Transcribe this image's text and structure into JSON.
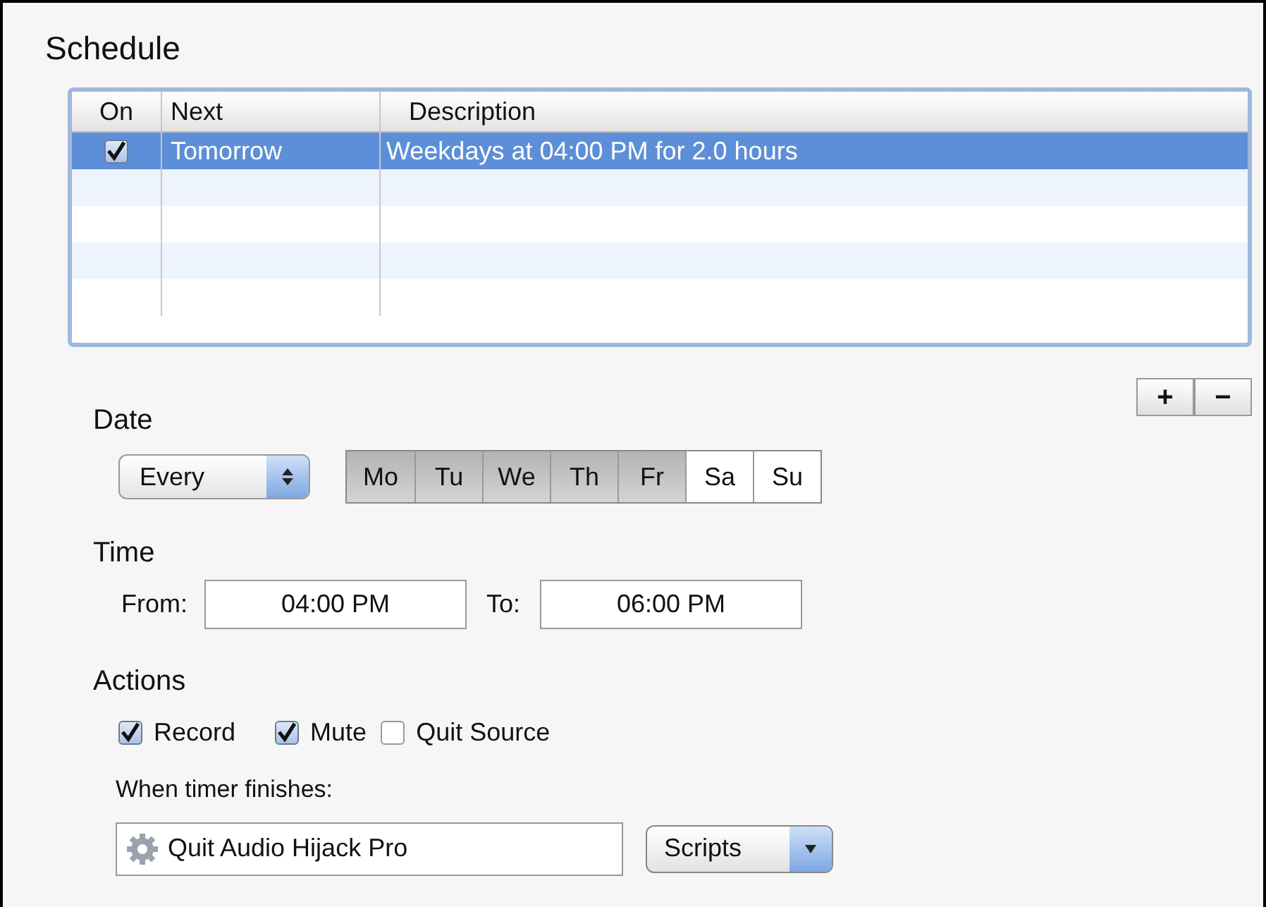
{
  "title": "Schedule",
  "table": {
    "columns": [
      "On",
      "Next",
      "Description"
    ],
    "rows": [
      {
        "on": true,
        "selected": true,
        "next": "Tomorrow",
        "description": "Weekdays at 04:00 PM for 2.0 hours"
      }
    ]
  },
  "list_buttons": [
    "+",
    "−"
  ],
  "date": {
    "label": "Date",
    "repeat": "Every",
    "days": [
      {
        "label": "Mo",
        "selected": true
      },
      {
        "label": "Tu",
        "selected": true
      },
      {
        "label": "We",
        "selected": true
      },
      {
        "label": "Th",
        "selected": true
      },
      {
        "label": "Fr",
        "selected": true
      },
      {
        "label": "Sa",
        "selected": false
      },
      {
        "label": "Su",
        "selected": false
      }
    ]
  },
  "time": {
    "label": "Time",
    "from_label": "From:",
    "from": "04:00 PM",
    "to_label": "To:",
    "to": "06:00 PM"
  },
  "actions": {
    "label": "Actions",
    "options": [
      {
        "label": "Record",
        "checked": true
      },
      {
        "label": "Mute",
        "checked": true
      },
      {
        "label": "Quit Source",
        "checked": false
      }
    ],
    "finish_label": "When timer finishes:",
    "finish_value": "Quit Audio Hijack Pro",
    "menu": "Scripts"
  }
}
